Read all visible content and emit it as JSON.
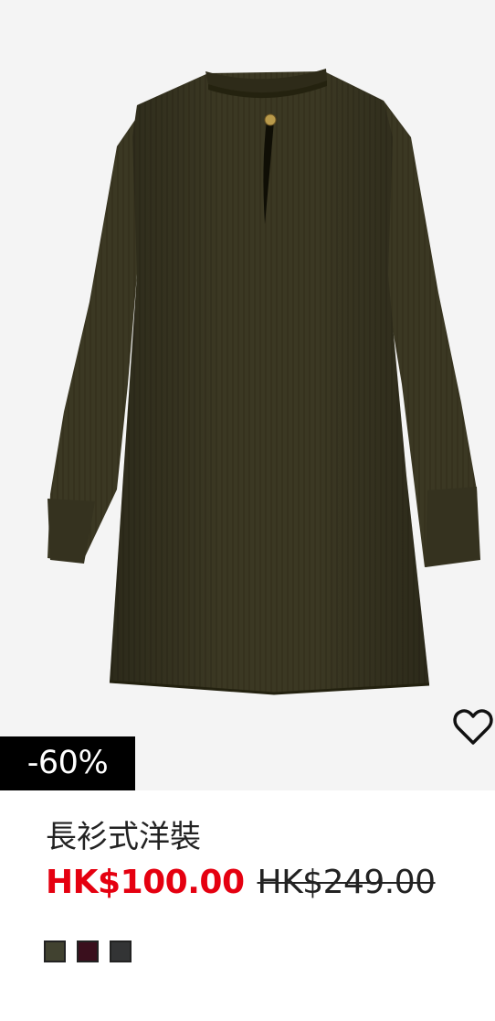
{
  "product": {
    "discount_badge": "-60%",
    "title": "長衫式洋裝",
    "sale_price": "HK$100.00",
    "original_price": "HK$249.00",
    "favorite_icon": "heart-outline-icon",
    "swatches": [
      {
        "name": "olive",
        "color": "#414230"
      },
      {
        "name": "burgundy",
        "color": "#3a0f1d"
      },
      {
        "name": "charcoal",
        "color": "#333435"
      }
    ],
    "colors": {
      "sale": "#e50010",
      "badge_bg": "#000000",
      "image_bg": "#f4f4f4"
    }
  }
}
